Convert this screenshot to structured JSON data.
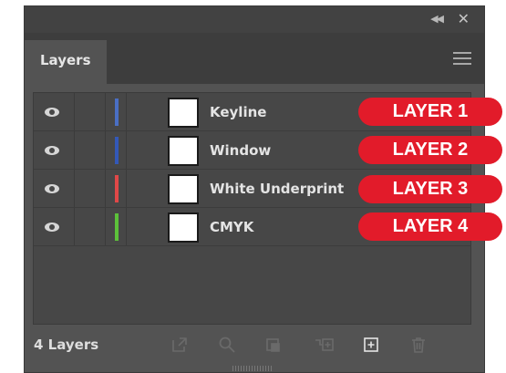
{
  "panel": {
    "tab_label": "Layers",
    "layer_count_label": "4 Layers",
    "layers": [
      {
        "name": "Keyline",
        "color": "#4a6fc4",
        "visible": true
      },
      {
        "name": "Window",
        "color": "#3358b8",
        "visible": true
      },
      {
        "name": "White Underprint",
        "color": "#e04848",
        "visible": true
      },
      {
        "name": "CMYK",
        "color": "#5cc13a",
        "visible": true
      }
    ]
  },
  "callouts": [
    "LAYER 1",
    "LAYER 2",
    "LAYER 3",
    "LAYER 4"
  ],
  "colors": {
    "callout_bg": "#e21b2a",
    "panel_bg": "#535353",
    "list_bg": "#474747"
  },
  "icons": {
    "titlebar": [
      "collapse-icon",
      "close-icon"
    ],
    "footer": [
      "export-icon",
      "locate-object-icon",
      "make-clipping-mask-icon",
      "create-sublayer-icon",
      "create-new-layer-icon",
      "delete-icon"
    ]
  }
}
